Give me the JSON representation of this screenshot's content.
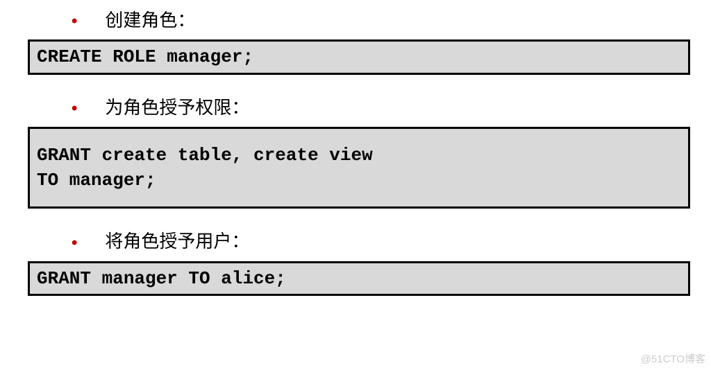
{
  "sections": [
    {
      "label": "创建角色：",
      "code": "CREATE ROLE manager;",
      "tall": false
    },
    {
      "label": "为角色授予权限：",
      "code": "GRANT create table, create view\nTO manager;",
      "tall": true
    },
    {
      "label": "将角色授予用户：",
      "code": "GRANT manager TO alice;",
      "tall": false
    }
  ],
  "watermark": "@51CTO博客"
}
